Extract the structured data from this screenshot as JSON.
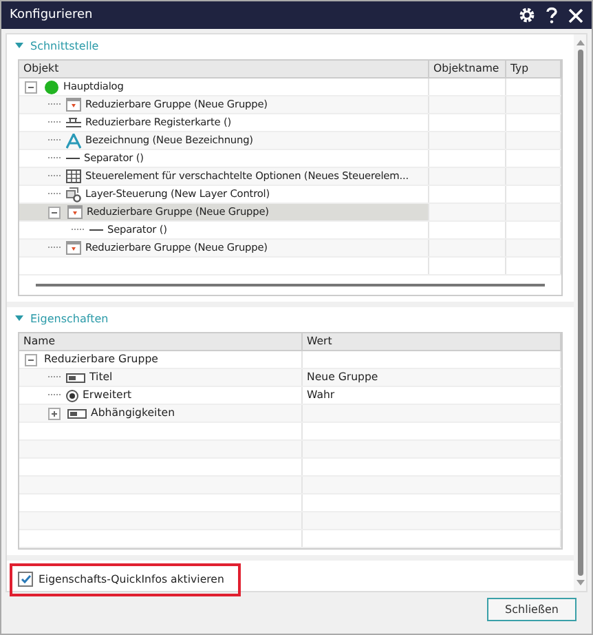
{
  "window": {
    "title": "Konfigurieren"
  },
  "interface": {
    "title": "Schnittstelle",
    "expanded": true,
    "columns": [
      "Objekt",
      "Objektname",
      "Typ"
    ],
    "tree": [
      {
        "label": "Hauptdialog",
        "kind": "dialog",
        "expanded": true,
        "selected": false,
        "children": [
          {
            "label": "Reduzierbare Gruppe (Neue Gruppe)",
            "kind": "group",
            "selected": false
          },
          {
            "label": "Reduzierbare Registerkarte ()",
            "kind": "tabs",
            "selected": false
          },
          {
            "label": "Bezeichnung (Neue Bezeichnung)",
            "kind": "label",
            "selected": false
          },
          {
            "label": "Separator ()",
            "kind": "separator",
            "selected": false
          },
          {
            "label": "Steuerelement für verschachtelte Optionen (Neues Steuerelem...",
            "kind": "grid",
            "selected": false
          },
          {
            "label": "Layer-Steuerung (New Layer Control)",
            "kind": "layer",
            "selected": false
          },
          {
            "label": "Reduzierbare Gruppe (Neue Gruppe)",
            "kind": "group",
            "expanded": true,
            "selected": true,
            "children": [
              {
                "label": "Separator ()",
                "kind": "separator",
                "selected": false
              }
            ]
          },
          {
            "label": "Reduzierbare Gruppe (Neue Gruppe)",
            "kind": "group",
            "selected": false
          }
        ]
      }
    ]
  },
  "properties": {
    "title": "Eigenschaften",
    "expanded": true,
    "columns": [
      "Name",
      "Wert"
    ],
    "tree": [
      {
        "label": "Reduzierbare Gruppe",
        "expanded": true,
        "children": [
          {
            "label": "Titel",
            "kind": "text",
            "value": "Neue Gruppe"
          },
          {
            "label": "Erweitert",
            "kind": "radio",
            "value": "Wahr"
          },
          {
            "label": "Abhängigkeiten",
            "kind": "text",
            "expanded": false
          }
        ]
      }
    ]
  },
  "quickinfo": {
    "label": "Eigenschafts-QuickInfos aktivieren",
    "checked": true
  },
  "close_button": "Schließen"
}
